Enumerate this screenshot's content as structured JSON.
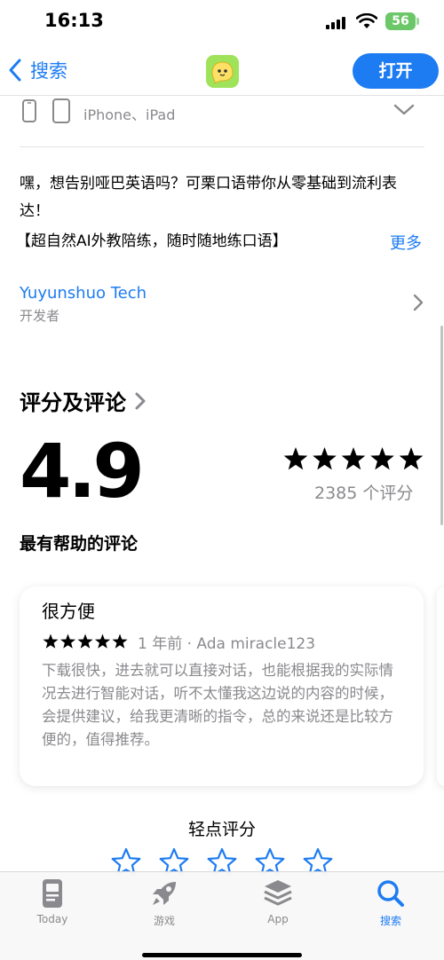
{
  "status_bar": {
    "time": "16:13",
    "battery": "56"
  },
  "nav": {
    "back_label": "搜索",
    "open_label": "打开"
  },
  "device": {
    "label": "iPhone、iPad"
  },
  "description": {
    "line1": "嘿，想告别哑巴英语吗？可栗口语带你从零基础到流利表达！",
    "line2": "【超自然AI外教陪练，随时随地练口语】",
    "more_label": "更多"
  },
  "developer": {
    "name": "Yuyunshuo Tech",
    "role": "开发者"
  },
  "ratings": {
    "title": "评分及评论",
    "average": "4.9",
    "stars": 5,
    "count_text": "2385 个评分",
    "helpful_title": "最有帮助的评论"
  },
  "review": {
    "title": "很方便",
    "stars": 5,
    "meta": "1 年前 · Ada miracle123",
    "body": "下载很快，进去就可以直接对话，也能根据我的实际情况去进行智能对话，听不太懂我这边说的内容的时候，会提供建议，给我更清晰的指令，总的来说还是比较方便的，值得推荐。"
  },
  "tap_to_rate": {
    "title": "轻点评分"
  },
  "tabs": [
    {
      "label": "Today",
      "icon": "today-icon",
      "active": false
    },
    {
      "label": "游戏",
      "icon": "rocket-icon",
      "active": false
    },
    {
      "label": "App",
      "icon": "app-stack-icon",
      "active": false
    },
    {
      "label": "搜索",
      "icon": "search-icon",
      "active": true
    }
  ],
  "colors": {
    "accent": "#1d7cf2",
    "secondary_text": "#8a8a8e",
    "battery": "#6cc768",
    "app_icon": "#9ee35a"
  }
}
